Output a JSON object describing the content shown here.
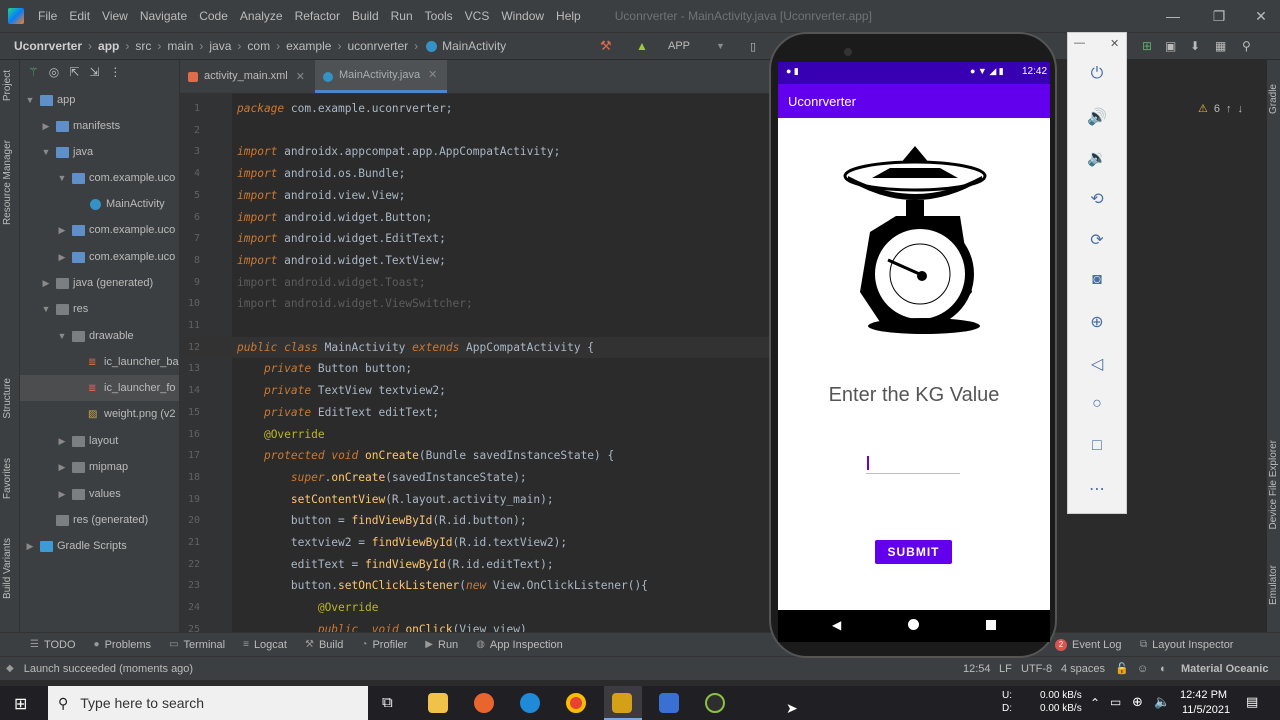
{
  "menu": {
    "items": [
      "File",
      "Edit",
      "View",
      "Navigate",
      "Code",
      "Analyze",
      "Refactor",
      "Build",
      "Run",
      "Tools",
      "VCS",
      "Window",
      "Help"
    ],
    "window_title": "Uconrverter - MainActivity.java [Uconrverter.app]"
  },
  "breadcrumb": [
    "Uconrverter",
    "app",
    "src",
    "main",
    "java",
    "com",
    "example",
    "uconrverter",
    "MainActivity"
  ],
  "run_config": "APP",
  "project_tree": {
    "items": [
      {
        "label": "app",
        "depth": 0,
        "type": "folder-module",
        "expanded": true
      },
      {
        "label": "manifests",
        "depth": 1,
        "type": "folder",
        "expanded": false
      },
      {
        "label": "java",
        "depth": 1,
        "type": "folder",
        "expanded": true
      },
      {
        "label": "com.example.uco",
        "depth": 2,
        "type": "package",
        "expanded": true
      },
      {
        "label": "MainActivity",
        "depth": 3,
        "type": "class"
      },
      {
        "label": "com.example.uco",
        "depth": 2,
        "type": "package",
        "expanded": false
      },
      {
        "label": "com.example.uco",
        "depth": 2,
        "type": "package",
        "expanded": false
      },
      {
        "label": "java (generated)",
        "depth": 1,
        "type": "folder",
        "expanded": false
      },
      {
        "label": "res",
        "depth": 1,
        "type": "folder",
        "expanded": true
      },
      {
        "label": "drawable",
        "depth": 2,
        "type": "folder",
        "expanded": true
      },
      {
        "label": "ic_launcher_ba",
        "depth": 3,
        "type": "xml"
      },
      {
        "label": "ic_launcher_fo",
        "depth": 3,
        "type": "xml"
      },
      {
        "label": "weight.png (v2",
        "depth": 3,
        "type": "image"
      },
      {
        "label": "layout",
        "depth": 2,
        "type": "folder",
        "expanded": false
      },
      {
        "label": "mipmap",
        "depth": 2,
        "type": "folder",
        "expanded": false
      },
      {
        "label": "values",
        "depth": 2,
        "type": "folder",
        "expanded": false
      },
      {
        "label": "res (generated)",
        "depth": 1,
        "type": "folder",
        "expanded": false
      },
      {
        "label": "Gradle Scripts",
        "depth": 0,
        "type": "gradle",
        "expanded": false
      }
    ]
  },
  "left_strip": [
    "Project",
    "Resource Manager",
    "Structure",
    "Favorites",
    "Build Variants"
  ],
  "right_strip": [
    "Gradle",
    "Device File Explorer",
    "Emulator"
  ],
  "editor": {
    "tabs": [
      {
        "label": "activity_main.xml",
        "active": false
      },
      {
        "label": "MainActivity.java",
        "active": true
      }
    ],
    "warnings": "6",
    "lines": [
      {
        "n": "1",
        "code": "package com.example.uconrverter;"
      },
      {
        "n": "2",
        "code": ""
      },
      {
        "n": "3",
        "code": "import androidx.appcompat.app.AppCompatActivity;"
      },
      {
        "n": "4",
        "code": "import android.os.Bundle;"
      },
      {
        "n": "5",
        "code": "import android.view.View;"
      },
      {
        "n": "6",
        "code": "import android.widget.Button;"
      },
      {
        "n": "7",
        "code": "import android.widget.EditText;"
      },
      {
        "n": "8",
        "code": "import android.widget.TextView;"
      },
      {
        "n": "9",
        "code": "import android.widget.Toast;"
      },
      {
        "n": "10",
        "code": "import android.widget.ViewSwitcher;"
      },
      {
        "n": "11",
        "code": ""
      },
      {
        "n": "12",
        "code": "public class MainActivity extends AppCompatActivity {"
      },
      {
        "n": "13",
        "code": "    private Button button;"
      },
      {
        "n": "14",
        "code": "    private TextView textview2;"
      },
      {
        "n": "15",
        "code": "    private EditText editText;"
      },
      {
        "n": "16",
        "code": "    @Override"
      },
      {
        "n": "17",
        "code": "    protected void onCreate(Bundle savedInstanceState) {"
      },
      {
        "n": "18",
        "code": "        super.onCreate(savedInstanceState);"
      },
      {
        "n": "19",
        "code": "        setContentView(R.layout.activity_main);"
      },
      {
        "n": "20",
        "code": "        button = findViewById(R.id.button);"
      },
      {
        "n": "21",
        "code": "        textview2 = findViewById(R.id.textView2);"
      },
      {
        "n": "22",
        "code": "        editText = findViewById(R.id.editText);"
      },
      {
        "n": "23",
        "code": "        button.setOnClickListener(new View.OnClickListener(){"
      },
      {
        "n": "24",
        "code": "            @Override"
      },
      {
        "n": "25",
        "code": "            public  void onClick(View view)"
      }
    ]
  },
  "bottom_tools": [
    "TODO",
    "Problems",
    "Terminal",
    "Logcat",
    "Build",
    "Profiler",
    "Run",
    "App Inspection"
  ],
  "bottom_right_tools": {
    "event_log": "Event Log",
    "event_count": "2",
    "layout_inspector": "Layout Inspector"
  },
  "status": {
    "message": "Launch succeeded (moments ago)",
    "position": "12:54",
    "line_sep": "LF",
    "encoding": "UTF-8",
    "indent": "4 spaces",
    "theme": "Material Oceanic"
  },
  "phone": {
    "time": "12:42",
    "app_title": "Uconrverter",
    "prompt": "Enter the KG Value",
    "input_value": "",
    "submit_label": "SUBMIT",
    "accent": "#6200ee",
    "status_color": "#3700b3"
  },
  "emulator_controls": [
    "power-icon",
    "volume-up-icon",
    "volume-down-icon",
    "rotate-left-icon",
    "rotate-right-icon",
    "camera-icon",
    "zoom-icon",
    "back-icon",
    "home-icon",
    "overview-icon",
    "more-icon"
  ],
  "taskbar": {
    "search_placeholder": "Type here to search",
    "net_up": "0.00 kB/s",
    "net_down": "0.00 kB/s",
    "net_up_label": "U:",
    "net_down_label": "D:",
    "time": "12:42 PM",
    "date": "11/5/2021"
  }
}
